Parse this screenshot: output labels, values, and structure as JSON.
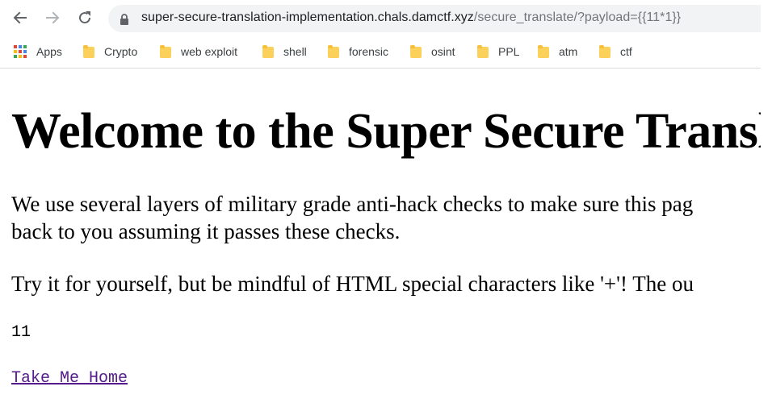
{
  "browser": {
    "url_host": "super-secure-translation-implementation.chals.damctf.xyz",
    "url_path": "/secure_translate/?payload={{11*1}}",
    "bookmarks": [
      {
        "label": "Apps",
        "icon": "apps-grid-icon"
      },
      {
        "label": "Crypto",
        "icon": "folder-icon"
      },
      {
        "label": "web exploit",
        "icon": "folder-icon"
      },
      {
        "label": "shell",
        "icon": "folder-icon"
      },
      {
        "label": "forensic",
        "icon": "folder-icon"
      },
      {
        "label": "osint",
        "icon": "folder-icon"
      },
      {
        "label": "PPL",
        "icon": "folder-icon"
      },
      {
        "label": "atm",
        "icon": "folder-icon"
      },
      {
        "label": "ctf",
        "icon": "folder-icon"
      }
    ]
  },
  "page": {
    "heading": "Welcome to the Super Secure Transl",
    "paragraph1_line1": "We use several layers of military grade anti-hack checks to make sure this pag",
    "paragraph1_line2": "back to you assuming it passes these checks.",
    "paragraph2": "Try it for yourself, but be mindful of HTML special characters like '+'! The ou",
    "result": "11",
    "home_link": "Take Me Home"
  },
  "colors": {
    "link_visited": "#551a8b",
    "omnibox_bg": "#f1f3f4",
    "folder": "#fbd15b"
  }
}
